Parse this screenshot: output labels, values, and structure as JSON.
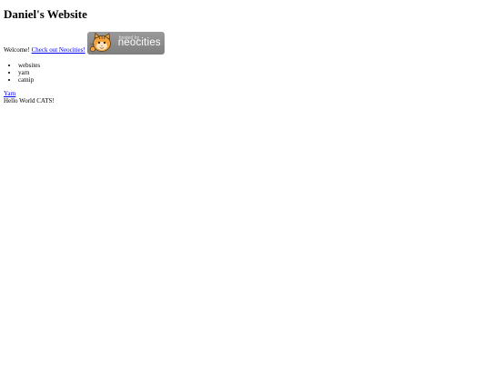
{
  "title": "Daniel's Website",
  "welcome": {
    "text": "Welcome!",
    "link_text": "Check out Neocities!"
  },
  "badge": {
    "hosted_text": "hosted by",
    "brand_text": "neocities"
  },
  "list": [
    "websites",
    "yarn",
    "catnip"
  ],
  "yarn_link": "Yarn",
  "hello_text": "Hello World CATS!"
}
